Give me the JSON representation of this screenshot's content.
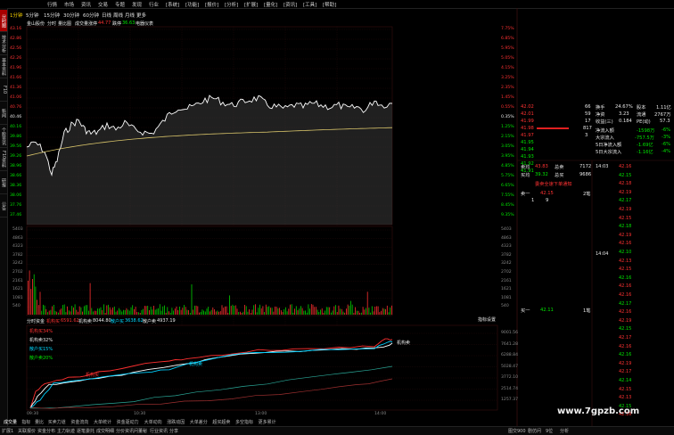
{
  "menu": [
    "行情",
    "市场",
    "资讯",
    "交易",
    "专题",
    "发现",
    "行业",
    "[系统]",
    "[功能]",
    "[报价]",
    "[分析]",
    "[扩展]",
    "[量化]",
    "[资讯]",
    "[工具]",
    "[帮助]"
  ],
  "sidebar_tabs": [
    "分时图",
    "技术分析",
    "基本资料",
    "F10",
    "新闻",
    "个股资讯",
    "F10资料",
    "研报",
    "公告"
  ],
  "timeframes": [
    "1分钟",
    "5分钟",
    "15分钟",
    "30分钟",
    "60分钟",
    "日线",
    "周线",
    "月线",
    "更多"
  ],
  "chart_header": {
    "name": "金山股份",
    "mode": "分时",
    "indicator": "量比图",
    "volume_label": "成交量",
    "change_label": "涨停",
    "change_value": "44.77",
    "limit_label": "跌停",
    "limit_value": "36.63",
    "extra": "电器仪表"
  },
  "price_axis_left": [
    "43.16",
    "42.86",
    "42.56",
    "42.26",
    "41.96",
    "41.66",
    "41.36",
    "41.06",
    "40.76",
    "40.46",
    "40.16",
    "39.86",
    "39.56",
    "39.26",
    "38.96",
    "38.66",
    "38.36",
    "38.06",
    "37.76",
    "37.46"
  ],
  "price_axis_right": [
    "7.75%",
    "6.85%",
    "5.95%",
    "5.05%",
    "4.15%",
    "3.25%",
    "2.35%",
    "1.45%",
    "0.55%",
    "0.35%",
    "1.25%",
    "2.15%",
    "3.05%",
    "3.95%",
    "4.85%",
    "5.75%",
    "6.65%",
    "7.55%",
    "8.45%",
    "9.35%"
  ],
  "volume_axis": [
    "5403",
    "4863",
    "4323",
    "3782",
    "3242",
    "2702",
    "2161",
    "1621",
    "1081",
    "540"
  ],
  "fund_header": {
    "label": "分时资金",
    "big1_label": "机构买",
    "big1": "6591.62",
    "big2_label": "机构卖",
    "big2": "8044.80",
    "big3_label": "散户买",
    "big3": "3638.62",
    "big4_label": "散户卖",
    "big4": "4937.19",
    "settings": "指标设置"
  },
  "fund_legend": [
    "机构买34%",
    "机构卖32%",
    "散户买15%",
    "散户卖20%"
  ],
  "fund_axis": [
    "9001.56",
    "7641.28",
    "6288.84",
    "5028.47",
    "3772.10",
    "2514.74",
    "1257.37"
  ],
  "time_axis": [
    "09:30",
    "10:30",
    "13:00",
    "14:00"
  ],
  "fund_line_labels": [
    "机构买",
    "机构卖",
    "散户买",
    "散户卖",
    "机构卖"
  ],
  "order_book_sell": [
    {
      "price": "42.02",
      "vol": "66"
    },
    {
      "price": "42.01",
      "vol": "59"
    },
    {
      "price": "41.99",
      "vol": "17"
    },
    {
      "price": "41.98",
      "vol": "817"
    },
    {
      "price": "41.97",
      "vol": "3"
    }
  ],
  "order_book_buy": [
    {
      "price": "41.95",
      "vol": "12"
    },
    {
      "price": "41.94",
      "vol": "1"
    },
    {
      "price": "41.93",
      "vol": "5"
    },
    {
      "price": "41.92",
      "vol": "1"
    },
    {
      "price": "41.91",
      "vol": "9"
    }
  ],
  "stats": [
    {
      "k": "换手",
      "v": "24.67%",
      "k2": "股本",
      "v2": "1.11亿"
    },
    {
      "k": "净资",
      "v": "3.23",
      "k2": "流通",
      "v2": "2767万"
    },
    {
      "k": "收益(三)",
      "v": "0.184",
      "k2": "PE(动)",
      "v2": "57.3"
    }
  ],
  "flows": [
    {
      "k": "净流入额",
      "v": "-1598万",
      "p": "-6%"
    },
    {
      "k": "大宗流入",
      "v": "-757.5万",
      "p": "-3%"
    },
    {
      "k": "5日净流入额",
      "v": "-1.69亿",
      "p": "-6%"
    },
    {
      "k": "5日大宗流入",
      "v": "-1.16亿",
      "p": "-4%"
    }
  ],
  "sell1": {
    "label": "卖均",
    "price": "43.83",
    "k": "总卖",
    "v": "7172"
  },
  "buy1": {
    "label": "买均",
    "price": "39.32",
    "k": "总买",
    "v": "9686"
  },
  "notice": "委卖全速下单通知",
  "level_sell": {
    "label": "卖一",
    "price": "42.15",
    "vol": "2笔",
    "n": "1",
    "m": "9"
  },
  "level_buy": {
    "label": "买一",
    "price": "42.11",
    "vol": "1笔"
  },
  "tick_time_a": "14:03",
  "tick_time_b": "14:04",
  "ticks_price": [
    "42.16",
    "42.15",
    "42.18",
    "42.19",
    "42.17",
    "42.19",
    "42.15",
    "42.18",
    "42.19",
    "42.16",
    "42.10",
    "42.13",
    "42.15",
    "42.16",
    "42.16",
    "42.16",
    "42.17",
    "42.16",
    "42.19",
    "42.15",
    "42.17",
    "42.16",
    "42.16",
    "42.19",
    "42.17",
    "42.14",
    "42.15",
    "42.13",
    "42.15",
    "42.16"
  ],
  "bottom_tabs": [
    "成交量",
    "指标",
    "量比",
    "买卖力道",
    "资金流向",
    "大单统计",
    "资金驱动力",
    "大单动向",
    "涨跌动因",
    "大单差分",
    "超买超卖",
    "多空指标",
    "更多累计"
  ],
  "status": [
    "扩展1",
    "关联报价",
    "资金分布",
    "主力轨迹",
    "逐笔委托",
    "成交明细",
    "分价资讯",
    "问董秘",
    "行业资讯",
    "分享"
  ],
  "status_right": [
    "图交900",
    "剧仿问",
    "9位",
    "分析"
  ],
  "watermark": "www.7gpzb.com"
}
